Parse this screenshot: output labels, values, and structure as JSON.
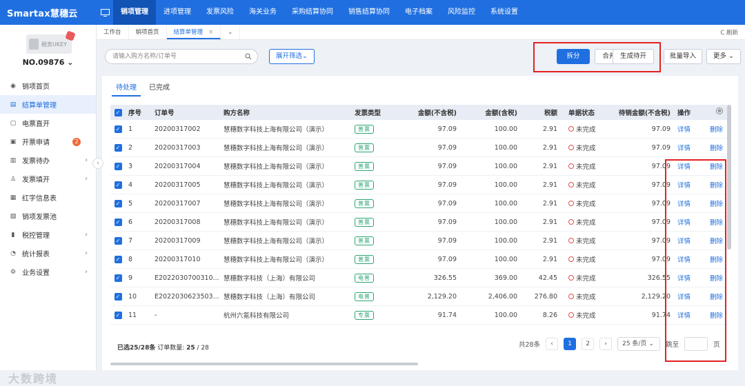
{
  "app": {
    "logo": "Smartax慧穗云"
  },
  "nav": [
    "销项管理",
    "进项管理",
    "发票风险",
    "海关业务",
    "采购结算协同",
    "销售结算协同",
    "电子档案",
    "风险监控",
    "系统设置"
  ],
  "sidebar": {
    "ukey_label": "税务UKEY",
    "org": "NO.09876",
    "items": [
      {
        "label": "销项首页",
        "icon": "home-icon"
      },
      {
        "label": "结算单管理",
        "icon": "document-icon"
      },
      {
        "label": "电票直开",
        "icon": "invoice-icon"
      },
      {
        "label": "开票申请",
        "icon": "apply-icon",
        "badge": "2"
      },
      {
        "label": "发票待办",
        "icon": "todo-icon"
      },
      {
        "label": "发票填开",
        "icon": "fill-icon"
      },
      {
        "label": "红字信息表",
        "icon": "red-letter-icon"
      },
      {
        "label": "销项发票池",
        "icon": "pool-icon"
      },
      {
        "label": "税控管理",
        "icon": "tax-icon"
      },
      {
        "label": "统计报表",
        "icon": "report-icon"
      },
      {
        "label": "业务设置",
        "icon": "settings-icon"
      }
    ],
    "watermark": "大数跨境"
  },
  "page_tabs": [
    "工作台",
    "销项首页",
    "结算单管理"
  ],
  "refresh_label": "C 刷新",
  "search": {
    "placeholder": "请输入购方名称/订单号"
  },
  "filter_label": "展开筛选",
  "actions": {
    "split": "拆分",
    "merge": "合并",
    "generate": "生成待开",
    "bulk_import": "批量导入",
    "more": "更多"
  },
  "subtabs": [
    "待处理",
    "已完成"
  ],
  "table": {
    "headers": [
      "序号",
      "订单号",
      "购方名称",
      "发票类型",
      "金额(不含税)",
      "金额(含税)",
      "税额",
      "单据状态",
      "待销金额(不含税)",
      "操作"
    ],
    "op_detail": "详情",
    "op_delete": "删除",
    "rows": [
      {
        "no": "1",
        "order": "20200317002",
        "buyer": "慧穗数字科技上海有限公司（演示）",
        "type": "普票",
        "amt": "97.09",
        "amt_tax": "100.00",
        "tax": "2.91",
        "status": "未完成",
        "pending": "97.09"
      },
      {
        "no": "2",
        "order": "20200317003",
        "buyer": "慧穗数字科技上海有限公司（演示）",
        "type": "普票",
        "amt": "97.09",
        "amt_tax": "100.00",
        "tax": "2.91",
        "status": "未完成",
        "pending": "97.09"
      },
      {
        "no": "3",
        "order": "20200317004",
        "buyer": "慧穗数字科技上海有限公司（演示）",
        "type": "普票",
        "amt": "97.09",
        "amt_tax": "100.00",
        "tax": "2.91",
        "status": "未完成",
        "pending": "97.09"
      },
      {
        "no": "4",
        "order": "20200317005",
        "buyer": "慧穗数字科技上海有限公司（演示）",
        "type": "普票",
        "amt": "97.09",
        "amt_tax": "100.00",
        "tax": "2.91",
        "status": "未完成",
        "pending": "97.09"
      },
      {
        "no": "5",
        "order": "20200317007",
        "buyer": "慧穗数字科技上海有限公司（演示）",
        "type": "普票",
        "amt": "97.09",
        "amt_tax": "100.00",
        "tax": "2.91",
        "status": "未完成",
        "pending": "97.09"
      },
      {
        "no": "6",
        "order": "20200317008",
        "buyer": "慧穗数字科技上海有限公司（演示）",
        "type": "普票",
        "amt": "97.09",
        "amt_tax": "100.00",
        "tax": "2.91",
        "status": "未完成",
        "pending": "97.09"
      },
      {
        "no": "7",
        "order": "20200317009",
        "buyer": "慧穗数字科技上海有限公司（演示）",
        "type": "普票",
        "amt": "97.09",
        "amt_tax": "100.00",
        "tax": "2.91",
        "status": "未完成",
        "pending": "97.09"
      },
      {
        "no": "8",
        "order": "20200317010",
        "buyer": "慧穗数字科技上海有限公司（演示）",
        "type": "普票",
        "amt": "97.09",
        "amt_tax": "100.00",
        "tax": "2.91",
        "status": "未完成",
        "pending": "97.09"
      },
      {
        "no": "9",
        "order": "E2022030700310...",
        "buyer": "慧穗数字科技（上海）有限公司",
        "type": "电普",
        "amt": "326.55",
        "amt_tax": "369.00",
        "tax": "42.45",
        "status": "未完成",
        "pending": "326.55"
      },
      {
        "no": "10",
        "order": "E2022030623503...",
        "buyer": "慧穗数字科技（上海）有限公司",
        "type": "电普",
        "amt": "2,129.20",
        "amt_tax": "2,406.00",
        "tax": "276.80",
        "status": "未完成",
        "pending": "2,129.20"
      },
      {
        "no": "11",
        "order": "-",
        "buyer": "杭州六氪科技有限公司",
        "type": "专票",
        "amt": "91.74",
        "amt_tax": "100.00",
        "tax": "8.26",
        "status": "未完成",
        "pending": "91.74"
      }
    ]
  },
  "footer": {
    "selected": "已选25/28条",
    "order_count_label": "订单数量:",
    "order_count": "25",
    "order_total": "/ 28",
    "total": "共28条",
    "pages": [
      "1",
      "2"
    ],
    "page_size": "25 条/页",
    "jump_label": "跳至",
    "page_unit": "页"
  },
  "colors": {
    "primary": "#1f6fe0",
    "highlight": "#e32020",
    "tag": "#2ba471"
  }
}
